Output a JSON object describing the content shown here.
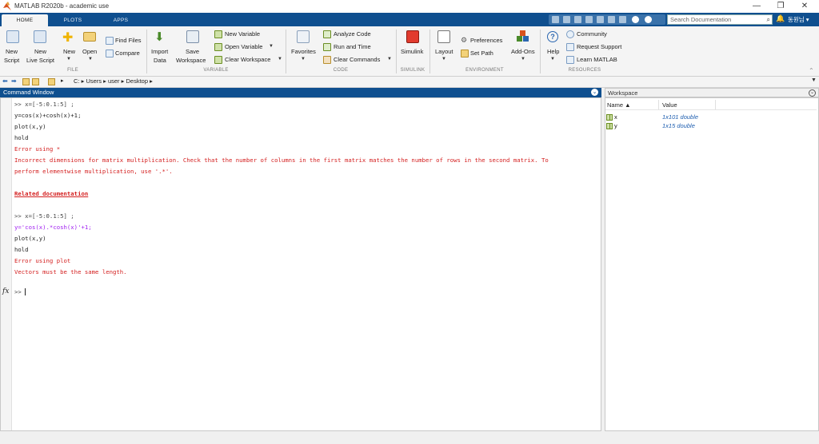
{
  "window": {
    "title": "MATLAB R2020b - academic use",
    "controls": [
      "—",
      "❐",
      "✕"
    ]
  },
  "tabs": [
    "HOME",
    "PLOTS",
    "APPS"
  ],
  "search": {
    "placeholder": "Search Documentation"
  },
  "user_menu": "동원님 ▾",
  "ribbon": {
    "file": {
      "group": "FILE",
      "new_script": [
        "New",
        "Script"
      ],
      "new_live_script": [
        "New",
        "Live Script"
      ],
      "new": "New",
      "open": "Open",
      "find_files": "Find Files",
      "compare": "Compare"
    },
    "variable": {
      "group": "VARIABLE",
      "import_data": [
        "Import",
        "Data"
      ],
      "save_workspace": [
        "Save",
        "Workspace"
      ],
      "new_variable": "New Variable",
      "open_variable": "Open Variable",
      "clear_workspace": "Clear Workspace"
    },
    "code": {
      "group": "CODE",
      "favorites": "Favorites",
      "analyze_code": "Analyze Code",
      "run_and_time": "Run and Time",
      "clear_commands": "Clear Commands"
    },
    "simulink": {
      "group": "SIMULINK",
      "label": "Simulink"
    },
    "environment": {
      "group": "ENVIRONMENT",
      "layout": "Layout",
      "preferences": "Preferences",
      "set_path": "Set Path",
      "add_ons": "Add-Ons"
    },
    "resources": {
      "group": "RESOURCES",
      "help": "Help",
      "community": "Community",
      "request_support": "Request Support",
      "learn_matlab": "Learn MATLAB"
    }
  },
  "address": {
    "path": [
      "C:",
      "Users",
      "user",
      "Desktop"
    ]
  },
  "command_window": {
    "title": "Command Window",
    "lines": [
      {
        "cls": "prompt",
        "text": ">> x=[-5:0.1:5] ;"
      },
      {
        "cls": "code",
        "text": "y=cos(x)+cosh(x)+1;"
      },
      {
        "cls": "code",
        "text": "plot(x,y)"
      },
      {
        "cls": "code",
        "text": "hold"
      },
      {
        "cls": "err",
        "text": "Error using  *"
      },
      {
        "cls": "err",
        "text": "Incorrect dimensions for matrix multiplication. Check that the number of columns in the first matrix matches the number of rows in the second matrix. To"
      },
      {
        "cls": "err",
        "text": "perform elementwise multiplication, use '.*'."
      },
      {
        "cls": "blank",
        "text": ""
      },
      {
        "cls": "link",
        "text": "Related documentation"
      },
      {
        "cls": "blank",
        "text": ""
      },
      {
        "cls": "prompt",
        "text": ">> x=[-5:0.1:5] ;"
      },
      {
        "cls": "str",
        "text": "y='cos(x).*cosh(x)'+1;"
      },
      {
        "cls": "code",
        "text": "plot(x,y)"
      },
      {
        "cls": "code",
        "text": "hold"
      },
      {
        "cls": "err",
        "text": "Error using plot"
      },
      {
        "cls": "err",
        "text": "Vectors must be the same length."
      }
    ],
    "prompt_fx": "fx",
    "prompt": ">>"
  },
  "workspace": {
    "title": "Workspace",
    "columns": [
      "Name ▲",
      "Value"
    ],
    "rows": [
      {
        "name": "x",
        "value": "1x101 double"
      },
      {
        "name": "y",
        "value": "1x15 double"
      }
    ]
  },
  "colors": {
    "accent_blue": "#0f4f8f",
    "error_red": "#d42020",
    "string_purple": "#a020f0",
    "value_blue": "#1f5fb0"
  }
}
